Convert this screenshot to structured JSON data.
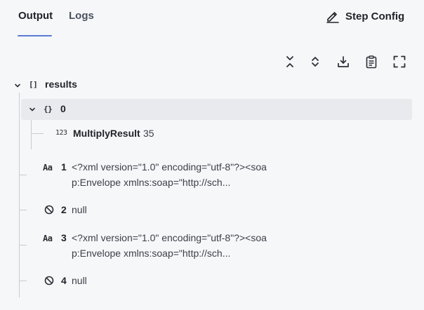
{
  "tabs": [
    {
      "label": "Output",
      "active": true
    },
    {
      "label": "Logs",
      "active": false
    }
  ],
  "step_config_label": "Step Config",
  "toolbar_icons": [
    "collapse-all-icon",
    "expand-all-icon",
    "download-icon",
    "clipboard-icon",
    "fullscreen-icon"
  ],
  "tree": {
    "root": {
      "type_icon": "[]",
      "key": "results"
    },
    "item0": {
      "type_icon": "{}",
      "key": "0"
    },
    "item0_child": {
      "type_icon": "123",
      "key": "MultiplyResult",
      "value": "35"
    },
    "item1": {
      "type_icon": "Aa",
      "key": "1",
      "value_line1": "<?xml version=\"1.0\" encoding=\"utf-8\"?><soa",
      "value_line2": "p:Envelope xmlns:soap=\"http://sch..."
    },
    "item2": {
      "key": "2",
      "value": "null"
    },
    "item3": {
      "type_icon": "Aa",
      "key": "3",
      "value_line1": "<?xml version=\"1.0\" encoding=\"utf-8\"?><soa",
      "value_line2": "p:Envelope xmlns:soap=\"http://sch..."
    },
    "item4": {
      "key": "4",
      "value": "null"
    }
  },
  "colors": {
    "accent": "#5a7bd6",
    "highlight": "#e8eaee",
    "background": "#f6f7f9"
  }
}
